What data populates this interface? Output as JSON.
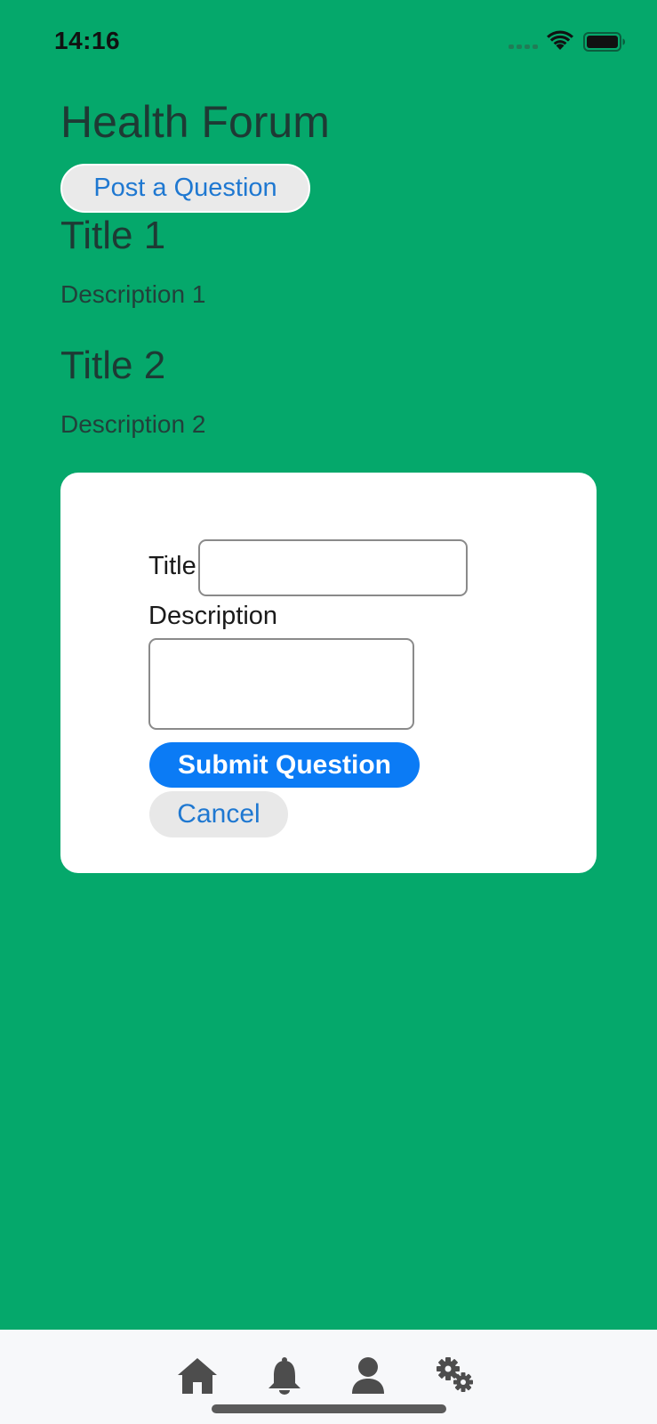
{
  "status_bar": {
    "time": "14:16"
  },
  "header": {
    "title": "Health Forum"
  },
  "actions": {
    "post_question_label": "Post a Question"
  },
  "posts": [
    {
      "title": "Title 1",
      "description": "Description 1"
    },
    {
      "title": "Title 2",
      "description": "Description 2"
    }
  ],
  "question_form": {
    "title_label": "Title",
    "title_value": "",
    "description_label": "Description",
    "description_value": "",
    "submit_label": "Submit Question",
    "cancel_label": "Cancel"
  },
  "tab_bar": {
    "items": [
      {
        "icon": "home-icon"
      },
      {
        "icon": "bell-icon"
      },
      {
        "icon": "user-icon"
      },
      {
        "icon": "gears-icon"
      }
    ]
  },
  "colors": {
    "background": "#05a86b",
    "primary_button": "#0b7bf5",
    "link_text": "#1f78d1"
  }
}
